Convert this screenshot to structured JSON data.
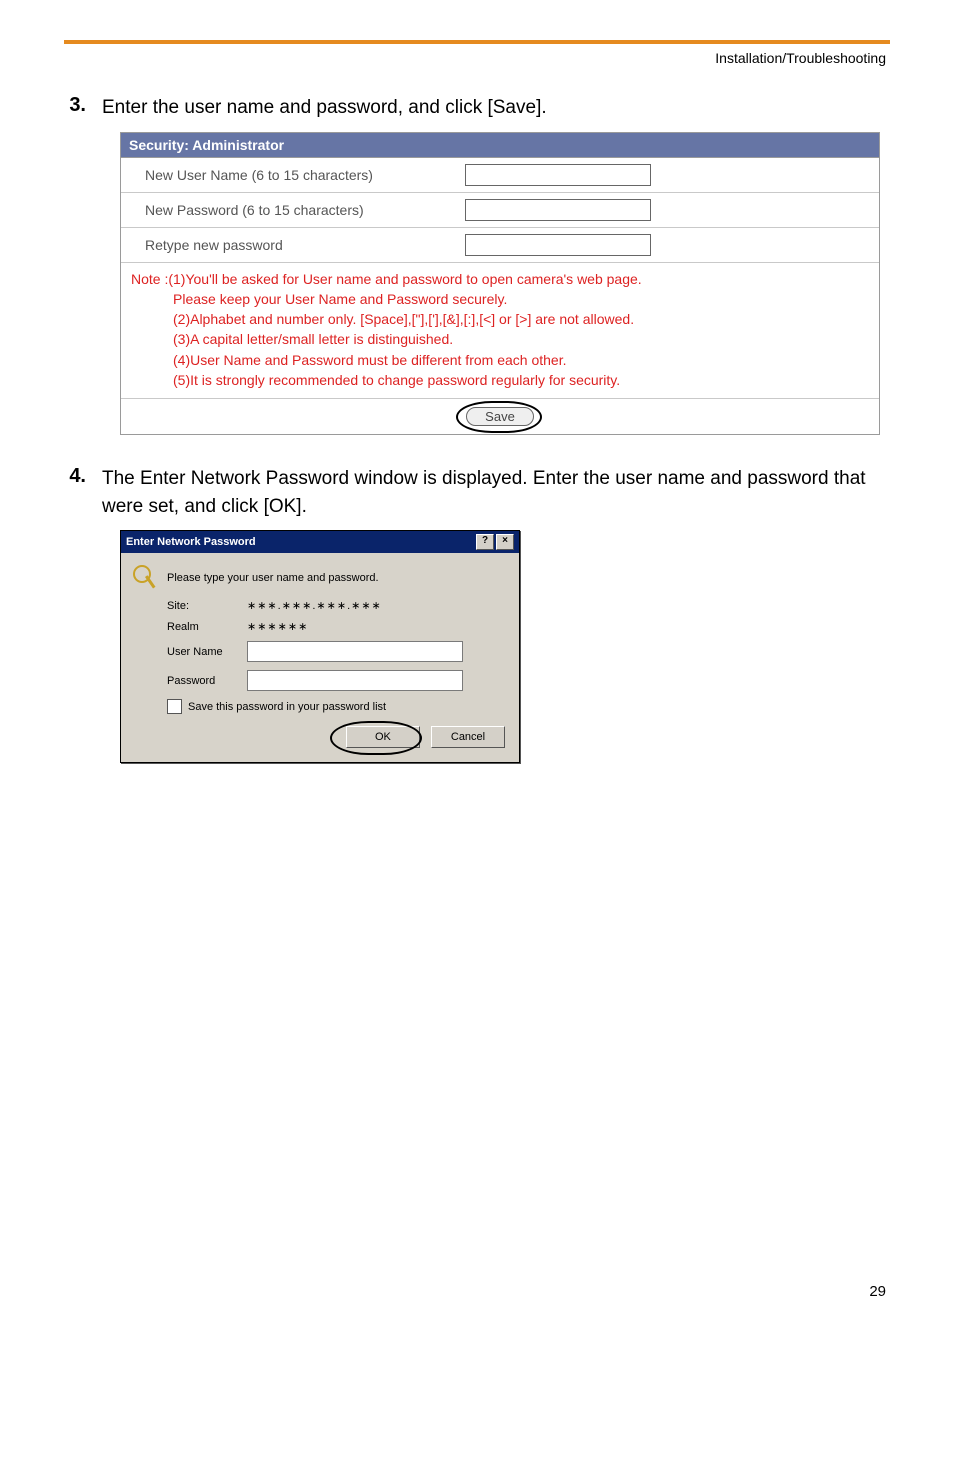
{
  "header": {
    "section": "Installation/Troubleshooting"
  },
  "step3": {
    "num": "3.",
    "text": "Enter the user name and password, and click [Save]."
  },
  "sec": {
    "title": "Security: Administrator",
    "row1": "New User Name (6 to 15 characters)",
    "row2": "New Password (6 to 15 characters)",
    "row3": "Retype new password",
    "note_prefix": "Note :",
    "note1": "(1)You'll be asked for User name and password to open camera's web page.",
    "note1b": "Please keep your User Name and Password securely.",
    "note2": "(2)Alphabet and number only. [Space],[\"],['],[&],[:],[<] or [>] are not allowed.",
    "note3": "(3)A capital letter/small letter is distinguished.",
    "note4": "(4)User Name and Password must be different from each other.",
    "note5": "(5)It is strongly recommended to change password regularly for security.",
    "save": "Save"
  },
  "step4": {
    "num": "4.",
    "text": "The Enter Network Password window is displayed. Enter the user name and password that were set, and click [OK]."
  },
  "dlg": {
    "title": "Enter Network Password",
    "help": "?",
    "close": "×",
    "prompt": "Please type your user name and password.",
    "site_lbl": "Site:",
    "site_val": "∗∗∗.∗∗∗.∗∗∗.∗∗∗",
    "realm_lbl": "Realm",
    "realm_val": "∗∗∗∗∗∗",
    "user_lbl": "User Name",
    "pass_lbl": "Password",
    "chk": "Save this password in your password list",
    "ok": "OK",
    "cancel": "Cancel"
  },
  "page_number": "29"
}
